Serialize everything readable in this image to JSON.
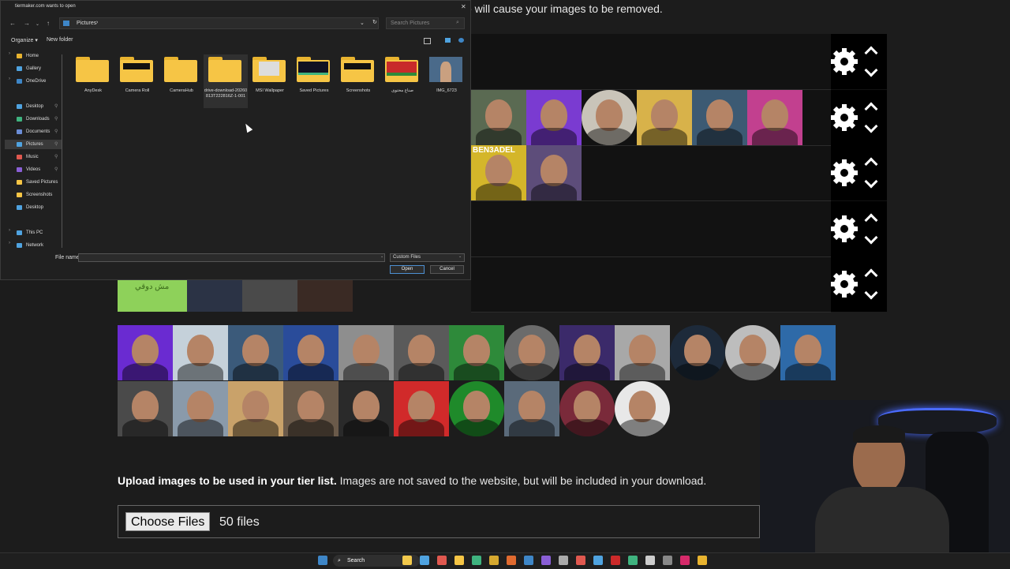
{
  "page": {
    "top_notice": "e will cause your images to be removed.",
    "upload_bold": "Upload images to be used in your tier list.",
    "upload_rest": " Images are not saved to the website, but will be included in your download.",
    "choose_files": "Choose Files",
    "file_count": "50 files",
    "partial_tile_text": "مش دوقي"
  },
  "dialog": {
    "title": "tiermaker.com wants to open",
    "address_label": "Pictures",
    "search_placeholder": "Search Pictures",
    "organize": "Organize ▾",
    "new_folder": "New folder",
    "file_name_label": "File name:",
    "file_type": "Custom Files",
    "open": "Open",
    "cancel": "Cancel",
    "nav": [
      {
        "label": "Home",
        "color": "#e8b32f"
      },
      {
        "label": "Gallery",
        "color": "#4fa3e0"
      },
      {
        "label": "OneDrive",
        "color": "#3e86c7"
      },
      {
        "label": "Desktop",
        "color": "#4fa3e0"
      },
      {
        "label": "Downloads",
        "color": "#3fb37f"
      },
      {
        "label": "Documents",
        "color": "#6b8dd6"
      },
      {
        "label": "Pictures",
        "color": "#4fa3e0"
      },
      {
        "label": "Music",
        "color": "#e0584f"
      },
      {
        "label": "Videos",
        "color": "#8a5fd6"
      },
      {
        "label": "Saved Pictures",
        "color": "#f6c545"
      },
      {
        "label": "Screenshots",
        "color": "#f6c545"
      },
      {
        "label": "Desktop",
        "color": "#4fa3e0"
      },
      {
        "label": "This PC",
        "color": "#4fa3e0"
      },
      {
        "label": "Network",
        "color": "#4fa3e0"
      }
    ],
    "files": [
      {
        "name": "AnyDesk",
        "kind": "folder"
      },
      {
        "name": "Camera Roll",
        "kind": "folder-dark"
      },
      {
        "name": "CameraHub",
        "kind": "folder"
      },
      {
        "name": "drive-download-20260813T222816Z-1-001",
        "kind": "folder"
      },
      {
        "name": "MSI Wallpaper",
        "kind": "folder-light"
      },
      {
        "name": "Saved Pictures",
        "kind": "folder-chart"
      },
      {
        "name": "Screenshots",
        "kind": "folder-dark"
      },
      {
        "name": "صناع محتوى",
        "kind": "folder-red"
      },
      {
        "name": "IMG_6723",
        "kind": "image"
      }
    ]
  },
  "tiers": {
    "row_count": 5,
    "row2_tile_colors": [
      "#5a6a52",
      "#7a3bd1",
      "#c9c4b9",
      "#d8b24a",
      "#3c5a73",
      "#c2408f"
    ],
    "row3_tile_colors": [
      "#d4b62a",
      "#5d4d7a"
    ],
    "row3_label": "BEN3ADEL",
    "partial_tile_colors": [
      "#8ed15a",
      "#2b3345",
      "#4a4a4a",
      "#3a2a24"
    ]
  },
  "pool": {
    "tile_colors": [
      [
        "#6a2bd1",
        "#c5d1da",
        "#3b5a7a",
        "#2a4c9a",
        "#8e8e8e",
        "#5a5a5a",
        "#2e8a3a",
        "#6b6b6b",
        "#3b2a6a",
        "#a8a8a8",
        "#1d2a3a",
        "#bdbdbd",
        "#2e6aa8"
      ],
      [
        "#4a4a4a",
        "#8a9aaa",
        "#c9a26a",
        "#6a5a4a",
        "#2a2a2a",
        "#d12a2a",
        "#1f8a2a",
        "#5a6a7a",
        "#7a2a3a",
        "#e8e8e8"
      ]
    ]
  },
  "taskbar": {
    "search": "Search",
    "icons": [
      "#f2c94c",
      "#4fa3e0",
      "#e0584f",
      "#f6c545",
      "#3fb37f",
      "#d6a82f",
      "#e06a2f",
      "#3e86c7",
      "#8a5fd6",
      "#aaaaaa",
      "#e0584f",
      "#4fa3e0",
      "#cc2a2a",
      "#3fb37f",
      "#cccccc",
      "#888888",
      "#d62a6a",
      "#e8b32f"
    ]
  }
}
